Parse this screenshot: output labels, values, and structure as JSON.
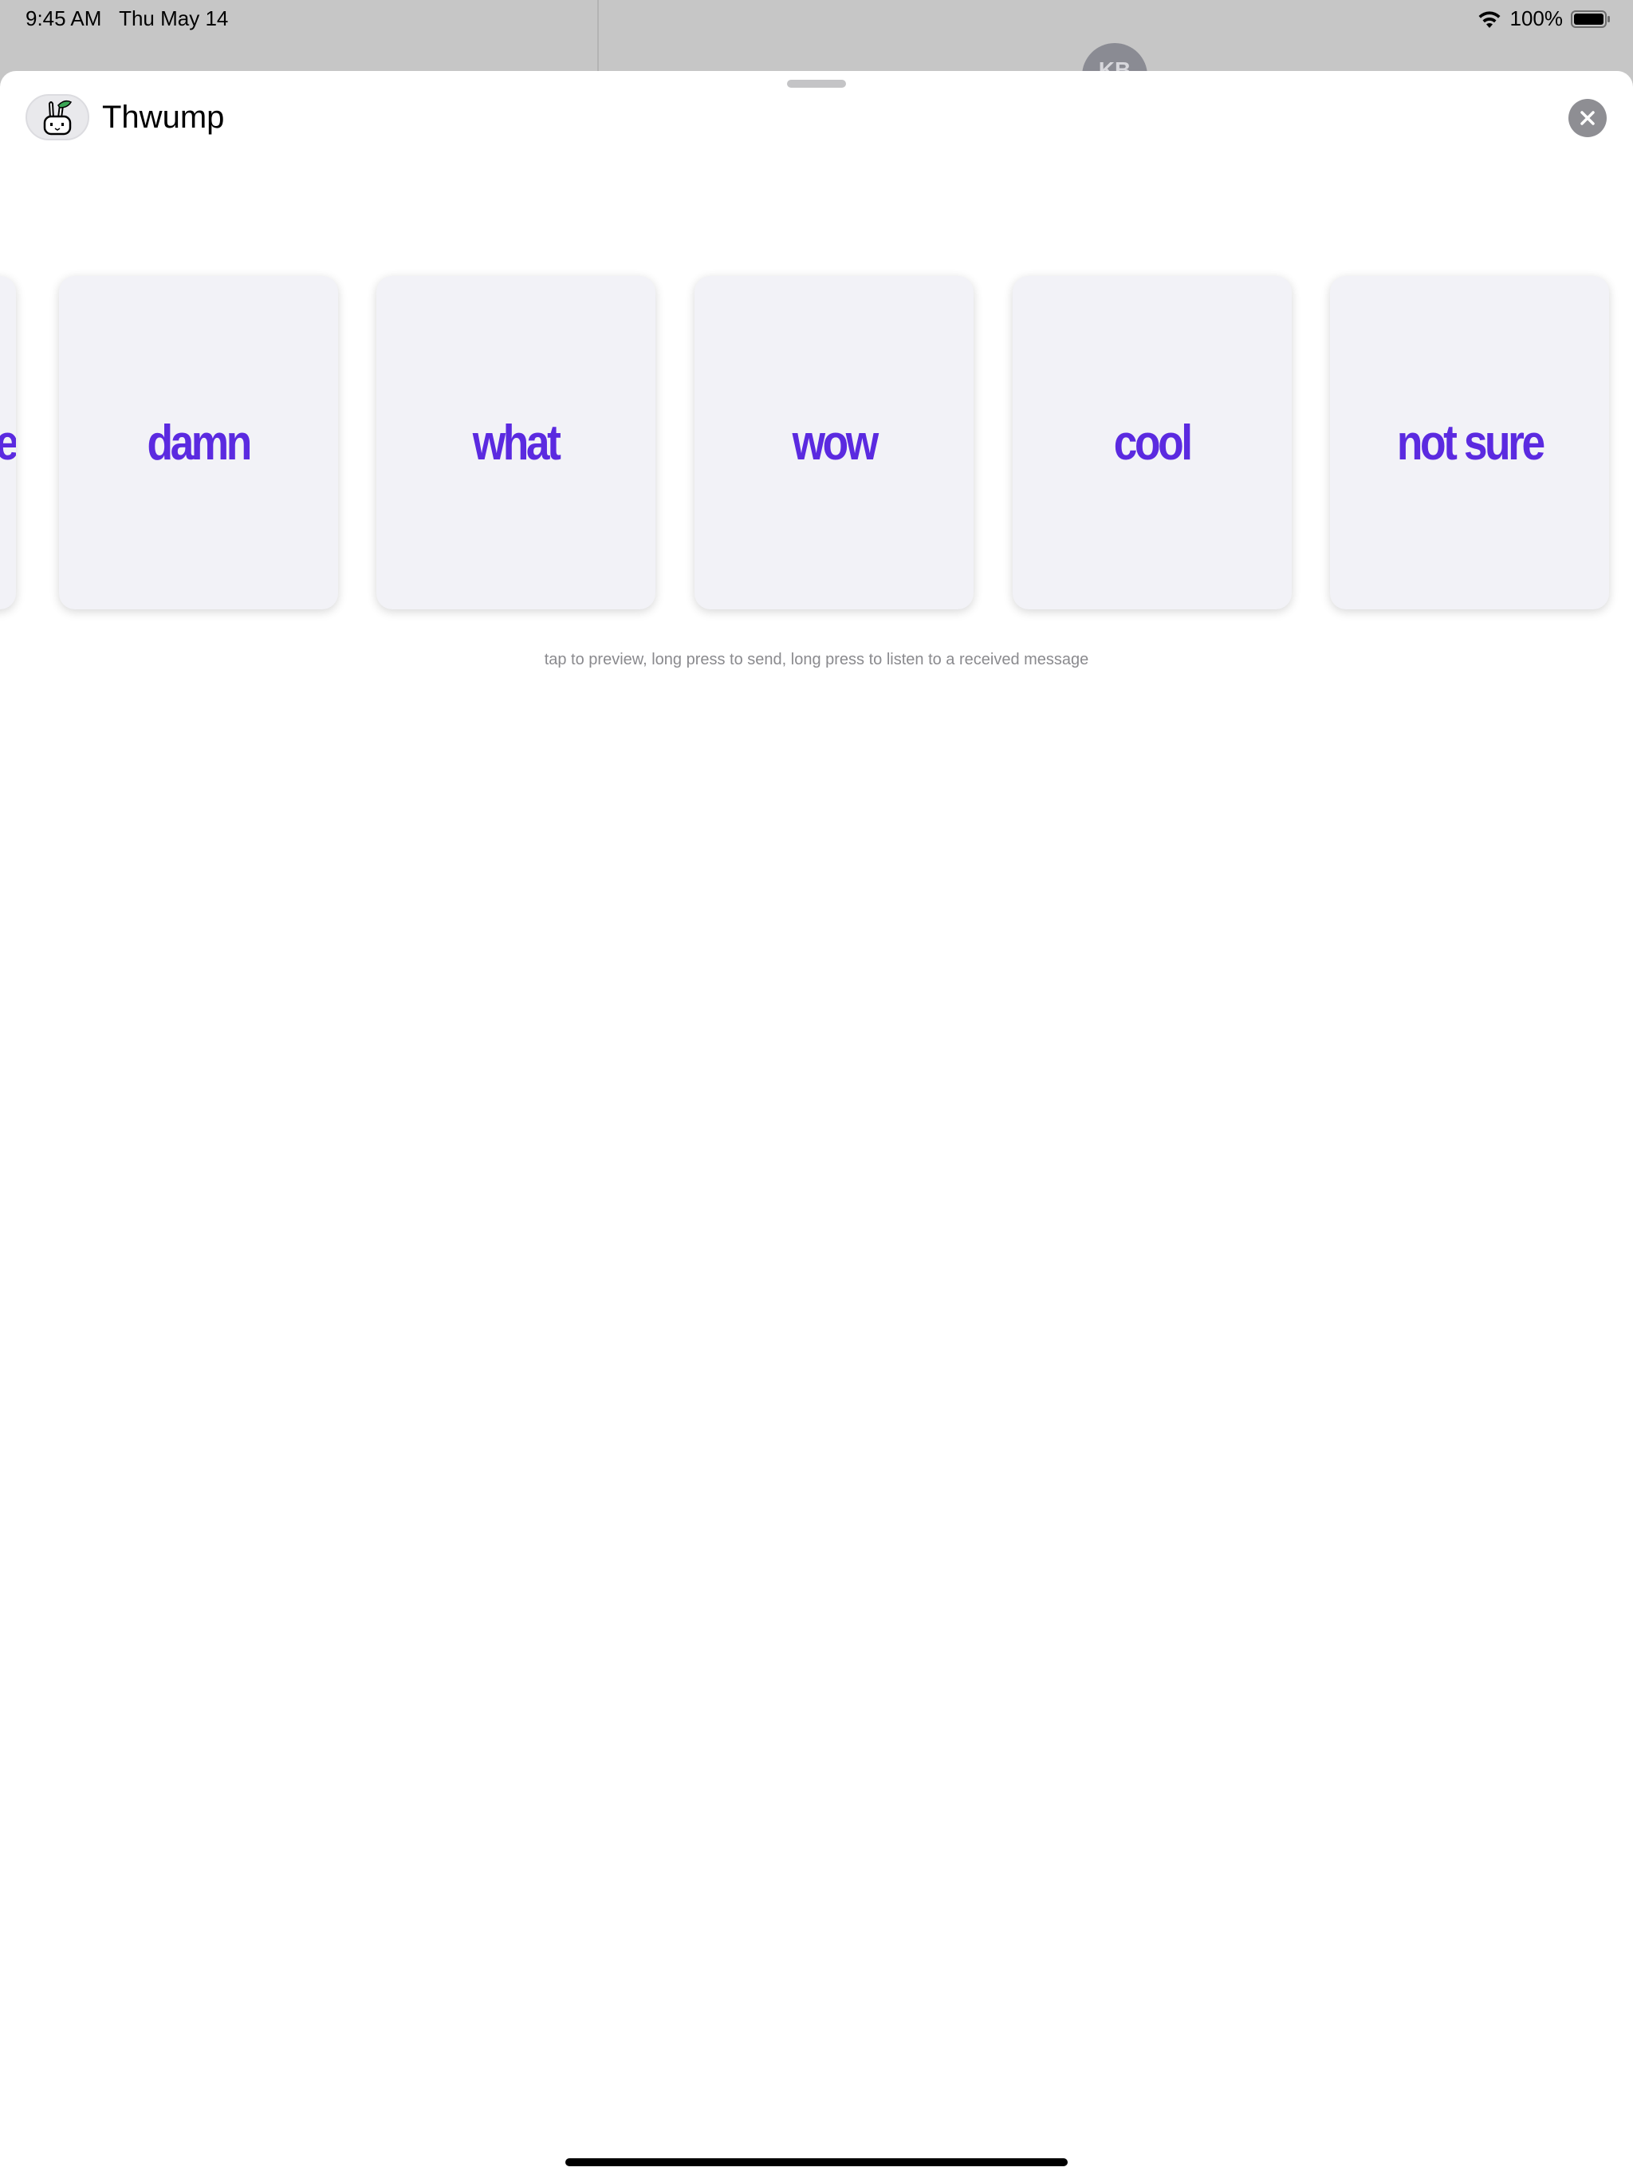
{
  "status_bar": {
    "time": "9:45 AM",
    "date": "Thu May 14",
    "battery_percent": "100%",
    "icons": [
      "wifi-icon",
      "battery-icon"
    ]
  },
  "background": {
    "avatar_initials": "KB"
  },
  "sheet": {
    "app_title": "Thwump",
    "app_icon": "bunny-app-icon",
    "close_icon": "close-icon"
  },
  "cards": [
    {
      "label": "e"
    },
    {
      "label": "damn"
    },
    {
      "label": "what"
    },
    {
      "label": "wow"
    },
    {
      "label": "cool"
    },
    {
      "label": "not sure"
    }
  ],
  "hint": "tap to preview, long press to send, long press to listen to a received message",
  "colors": {
    "card_text": "#5b2ae0",
    "card_bg": "#f2f2f7",
    "close_button_bg": "#8e8e93"
  }
}
